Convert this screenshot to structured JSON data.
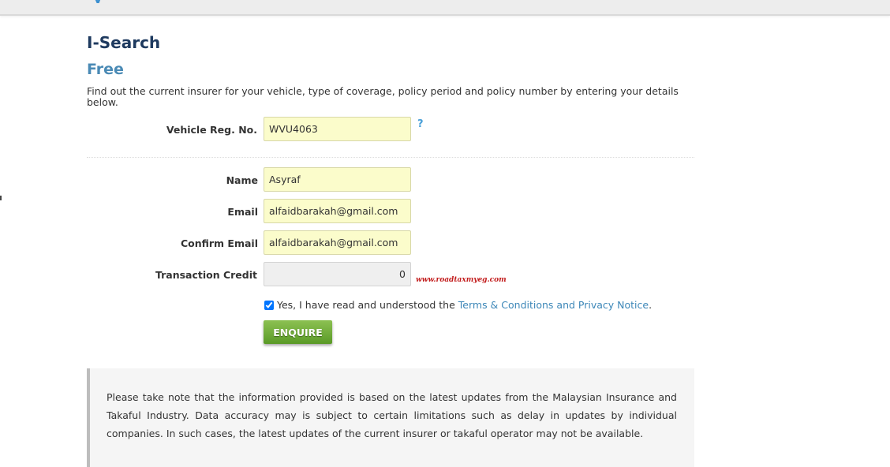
{
  "header": {
    "logo_fragment": "y"
  },
  "page": {
    "title": "I-Search",
    "subtitle": "Free",
    "intro": "Find out the current insurer for your vehicle, type of coverage, policy period and policy number by entering your details below."
  },
  "form": {
    "vehicle_reg": {
      "label": "Vehicle Reg. No.",
      "value": "WVU4063",
      "help_label": "?"
    },
    "name": {
      "label": "Name",
      "value": "Asyraf"
    },
    "email": {
      "label": "Email",
      "value": "alfaidbarakah@gmail.com"
    },
    "confirm_email": {
      "label": "Confirm Email",
      "value": "alfaidbarakah@gmail.com"
    },
    "transaction_credit": {
      "label": "Transaction Credit",
      "value": "0"
    },
    "terms": {
      "checked": true,
      "text_prefix": "Yes, I have read and understood the ",
      "link_text": "Terms & Conditions and Privacy Notice",
      "text_suffix": "."
    },
    "submit_label": "ENQUIRE"
  },
  "watermark": "www.roadtaxmyeg.com",
  "notice": {
    "text": "Please take note that the information provided is based on the latest updates from the Malaysian Insurance and Takaful Industry. Data accuracy may is subject to certain limitations such as delay in updates by individual companies. In such cases, the latest updates of the current insurer or takaful operator may not be available."
  },
  "colors": {
    "title": "#1e3a5f",
    "subtitle": "#4a8ab5",
    "link": "#3d87b8",
    "input_bg": "#fbfccb",
    "button_green": "#6aa832",
    "watermark_red": "#c21c1c"
  }
}
